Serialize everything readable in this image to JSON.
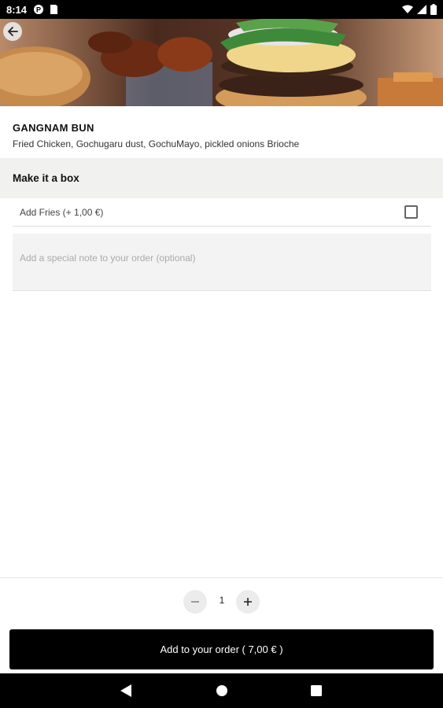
{
  "status_bar": {
    "time": "8:14"
  },
  "item": {
    "title": "GANGNAM BUN",
    "description": "Fried Chicken, Gochugaru dust, GochuMayo, pickled onions Brioche"
  },
  "section": {
    "title": "Make it a box"
  },
  "option": {
    "label": "Add Fries (+ 1,00 €)",
    "checked": false
  },
  "note": {
    "placeholder": "Add a special note to your order (optional)",
    "value": ""
  },
  "quantity": {
    "value": "1"
  },
  "add_button": {
    "label": "Add to your order ( 7,00 € )"
  },
  "colors": {
    "primary": "#000000",
    "section_bg": "#f1f1ef",
    "field_bg": "#f3f3f3"
  },
  "icons": [
    "arrow-back-icon",
    "minus-icon",
    "plus-icon",
    "checkbox-icon",
    "nav-back-icon",
    "nav-home-icon",
    "nav-recents-icon"
  ]
}
